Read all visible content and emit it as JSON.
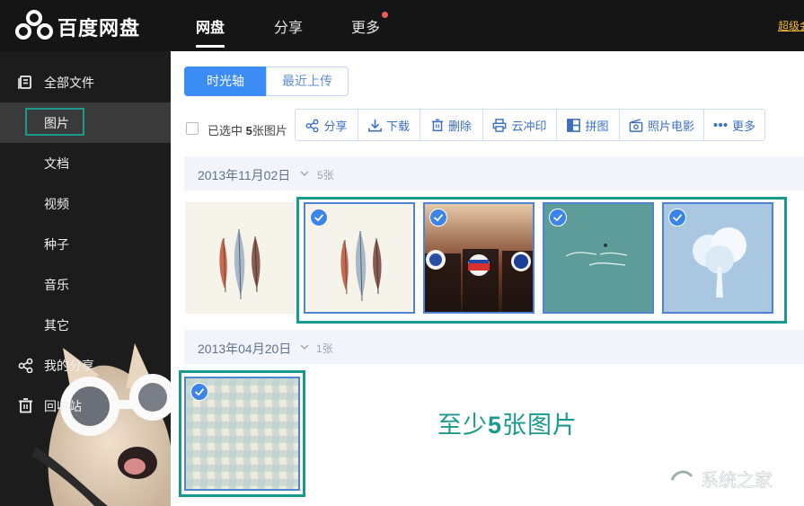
{
  "app": {
    "title": "百度网盘"
  },
  "topnav": {
    "items": [
      "网盘",
      "分享",
      "更多"
    ],
    "right_link": "超级会员"
  },
  "sidebar": {
    "items": [
      {
        "label": "全部文件",
        "icon": "all-files-icon"
      },
      {
        "label": "图片"
      },
      {
        "label": "文档"
      },
      {
        "label": "视频"
      },
      {
        "label": "种子"
      },
      {
        "label": "音乐"
      },
      {
        "label": "其它"
      },
      {
        "label": "我的分享",
        "icon": "share-icon"
      },
      {
        "label": "回收站",
        "icon": "trash-icon"
      }
    ],
    "selected": "图片"
  },
  "view_tabs": {
    "timeline": "时光轴",
    "recent": "最近上传"
  },
  "selection": {
    "prefix": "已选中",
    "count": "5",
    "suffix": "张图片"
  },
  "toolbar": {
    "buttons": [
      {
        "label": "分享",
        "icon": "share-icon"
      },
      {
        "label": "下载",
        "icon": "download-icon"
      },
      {
        "label": "删除",
        "icon": "trash-icon"
      },
      {
        "label": "云冲印",
        "icon": "printer-icon"
      },
      {
        "label": "拼图",
        "icon": "collage-icon"
      },
      {
        "label": "照片电影",
        "icon": "film-icon"
      },
      {
        "label": "更多",
        "icon": "more-dots-icon"
      }
    ]
  },
  "groups": [
    {
      "date": "2013年11月02日",
      "count": "5张",
      "photos": [
        "feathers-photo",
        "feathers-photo",
        "bottle-caps-photo",
        "teal-text-photo",
        "white-tree-photo"
      ],
      "selected": [
        false,
        true,
        true,
        true,
        true
      ]
    },
    {
      "date": "2013年04月20日",
      "count": "1张",
      "photos": [
        "gingham-photo"
      ],
      "selected": [
        true
      ]
    }
  ],
  "annotation": {
    "before": "至少",
    "number": "5",
    "after": "张图片"
  },
  "watermark": {
    "text": "系统之家"
  },
  "colors": {
    "accent": "#3b8cf5",
    "annotation": "#1a9a8c",
    "sidebar_bg": "#1c1c1c",
    "topbar_bg": "#151515"
  }
}
